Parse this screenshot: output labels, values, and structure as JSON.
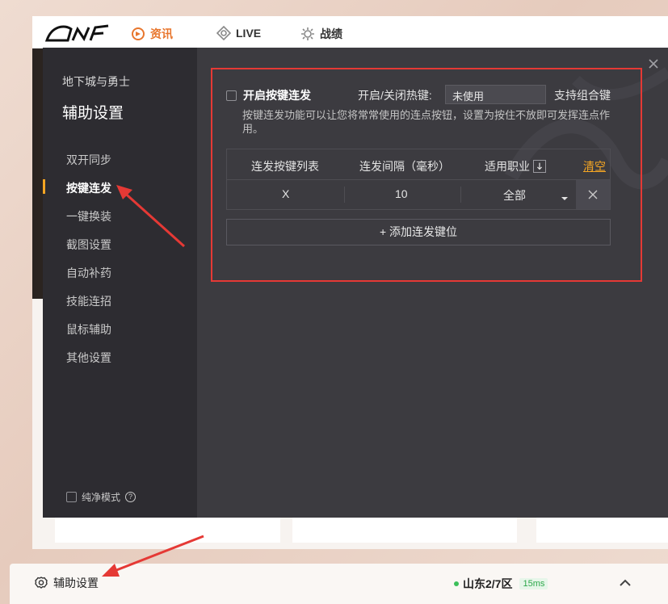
{
  "launcher": {
    "tabs": [
      {
        "label": "资讯",
        "icon": "news-icon",
        "active": true
      },
      {
        "label": "LIVE",
        "icon": "live-icon",
        "active": false
      },
      {
        "label": "战绩",
        "icon": "gear-stats-icon",
        "active": false
      }
    ]
  },
  "dialog": {
    "game_name": "地下城与勇士",
    "title": "辅助设置",
    "sidebar_items": [
      {
        "label": "双开同步",
        "active": false
      },
      {
        "label": "按键连发",
        "active": true
      },
      {
        "label": "一键换装",
        "active": false
      },
      {
        "label": "截图设置",
        "active": false
      },
      {
        "label": "自动补药",
        "active": false
      },
      {
        "label": "技能连招",
        "active": false
      },
      {
        "label": "鼠标辅助",
        "active": false
      },
      {
        "label": "其他设置",
        "active": false
      }
    ],
    "pure_mode_label": "纯净模式",
    "help_glyph": "?",
    "enable_label": "开启按键连发",
    "hotkey_label": "开启/关闭热键:",
    "hotkey_value": "未使用",
    "combo_label": "支持组合键",
    "description": "按键连发功能可以让您将常常使用的连点按钮，设置为按住不放即可发挥连点作用。",
    "table": {
      "headers": [
        "连发按键列表",
        "连发间隔（毫秒）",
        "适用职业"
      ],
      "clear_label": "清空",
      "rows": [
        {
          "key": "X",
          "interval": "10",
          "profession": "全部"
        }
      ]
    },
    "add_button_label": "+ 添加连发键位"
  },
  "bottom_bar": {
    "settings_label": "辅助设置",
    "server": "山东2/7区",
    "ping": "15ms"
  },
  "colors": {
    "accent_orange": "#f5a623",
    "annotation_red": "#e53935",
    "status_green": "#3cbf5a"
  }
}
